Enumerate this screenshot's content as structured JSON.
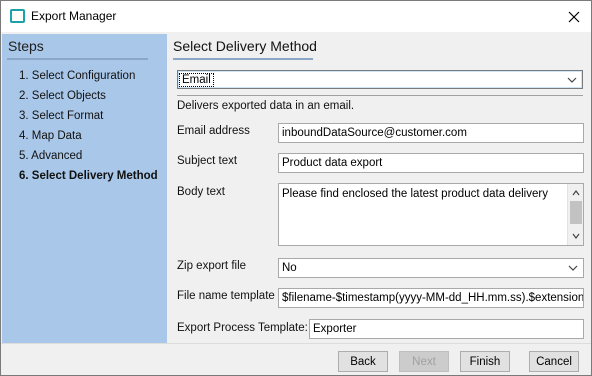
{
  "window": {
    "title": "Export Manager",
    "app_icon": "export-manager-icon",
    "close_icon": "close-icon"
  },
  "sidebar": {
    "header": "Steps",
    "steps": [
      "1. Select Configuration",
      "2. Select Objects",
      "3. Select Format",
      "4. Map Data",
      "5. Advanced",
      "6. Select Delivery Method"
    ],
    "active_step": 5
  },
  "main": {
    "title": "Select Delivery Method",
    "delivery_method": "Email",
    "description": "Delivers exported data in an email.",
    "fields": {
      "email_address": {
        "label": "Email address",
        "value": "inboundDataSource@customer.com"
      },
      "subject_text": {
        "label": "Subject text",
        "value": "Product data export"
      },
      "body_text": {
        "label": "Body text",
        "value": "Please find enclosed the latest product data delivery"
      },
      "zip_export_file": {
        "label": "Zip export file",
        "value": "No"
      },
      "file_name_template": {
        "label": "File name template",
        "value": "$filename-$timestamp(yyyy-MM-dd_HH.mm.ss).$extension"
      },
      "export_process_template": {
        "label": "Export Process Template:",
        "value": "Exporter"
      }
    }
  },
  "footer": {
    "back": "Back",
    "next": "Next",
    "next_enabled": false,
    "finish": "Finish",
    "cancel": "Cancel"
  },
  "colors": {
    "sidebar_bg": "#a9c7e8",
    "accent_rule": "#8aa7c7",
    "icon_teal": "#1ba1a8"
  }
}
